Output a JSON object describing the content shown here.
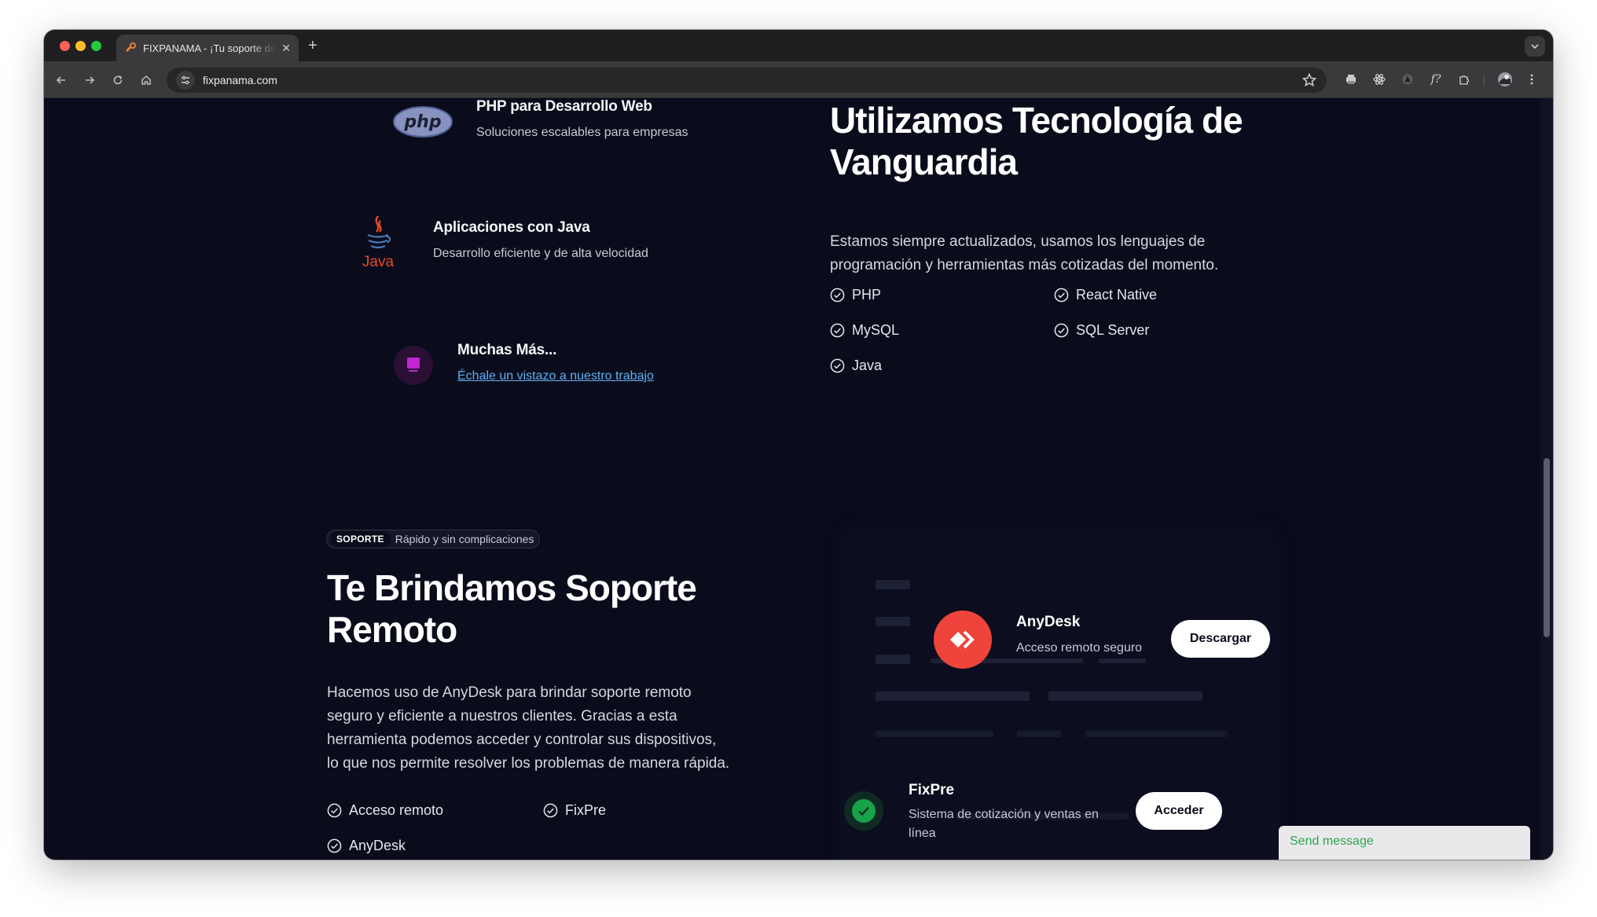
{
  "browser": {
    "tab_title": "FIXPANAMA - ¡Tu soporte de",
    "url": "fixpanama.com"
  },
  "tech": {
    "php": {
      "title": "PHP para Desarrollo Web",
      "desc": "Soluciones escalables para empresas",
      "logo_text": "php"
    },
    "java": {
      "title": "Aplicaciones con Java",
      "desc": "Desarrollo eficiente y de alta velocidad",
      "logo_text": "Java"
    },
    "more": {
      "title": "Muchas Más...",
      "link": "Échale un vistazo a nuestro trabajo"
    }
  },
  "vanguardia": {
    "heading_line1": "Utilizamos Tecnología de",
    "heading_line2": "Vanguardia",
    "lead_line1": "Estamos siempre actualizados, usamos los lenguajes de",
    "lead_line2": "programación y herramientas más cotizadas del momento.",
    "checks": [
      "PHP",
      "React Native",
      "MySQL",
      "SQL Server",
      "Java"
    ]
  },
  "soporte": {
    "badge_tag": "SOPORTE",
    "badge_text": "Rápido y sin complicaciones",
    "heading_line1": "Te Brindamos Soporte",
    "heading_line2": "Remoto",
    "lead_lines": [
      "Hacemos uso de AnyDesk para brindar soporte remoto",
      "seguro y eficiente a nuestros clientes. Gracias a esta",
      "herramienta podemos acceder y controlar sus dispositivos,",
      "lo que nos permite resolver los problemas de manera rápida."
    ],
    "checks": [
      "Acceso remoto",
      "FixPre",
      "AnyDesk"
    ]
  },
  "cards": {
    "anydesk": {
      "title": "AnyDesk",
      "sub": "Acceso remoto seguro",
      "button": "Descargar"
    },
    "fixpre": {
      "title": "FixPre",
      "sub_line1": "Sistema de cotización y ventas en",
      "sub_line2": "línea",
      "button": "Acceder"
    }
  },
  "chat": {
    "label": "Send message"
  },
  "colors": {
    "page_bg": "#0a0c1c",
    "link": "#5fb0f2",
    "anydesk_red": "#ef443b",
    "fixpre_green": "#16a34a",
    "more_icon": "#c026d3",
    "chat_text": "#2ea44f"
  },
  "icons": [
    "back-icon",
    "forward-icon",
    "reload-icon",
    "home-icon",
    "site-settings-icon",
    "star-icon",
    "check-circle-icon",
    "anydesk-logo",
    "checkmark-icon"
  ]
}
